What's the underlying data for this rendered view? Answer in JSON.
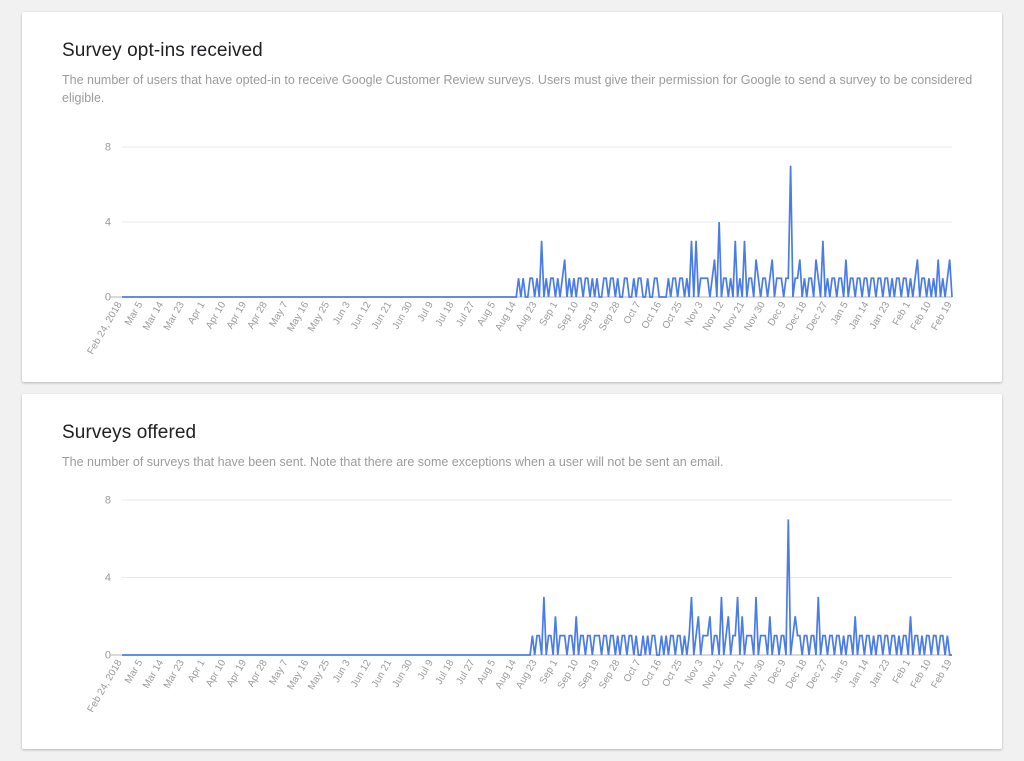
{
  "page": {
    "background_color": "#f1f1f1",
    "card_background": "#ffffff"
  },
  "cards": [
    {
      "id": "survey-opt-ins-received",
      "title": "Survey opt-ins received",
      "subtitle": "The number of users that have opted-in to receive Google Customer Review surveys. Users must give their permission for Google to send a survey to be considered eligible."
    },
    {
      "id": "surveys-offered",
      "title": "Surveys offered",
      "subtitle": "The number of surveys that have been sent. Note that there are some exceptions when a user will not be sent an email."
    }
  ],
  "chart_data": [
    {
      "type": "line",
      "title": "Survey opt-ins received",
      "xlabel": "",
      "ylabel": "",
      "grid": true,
      "legend": "none",
      "line_color": "#4a7ce8",
      "ylim": [
        0,
        8
      ],
      "yticks": [
        0,
        4,
        8
      ],
      "ytick_labels": [
        "0",
        "4",
        "8"
      ],
      "xtick_labels": [
        "Feb 24, 2018",
        "Mar 5",
        "Mar 14",
        "Mar 23",
        "Apr 1",
        "Apr 10",
        "Apr 19",
        "Apr 28",
        "May 7",
        "May 16",
        "May 25",
        "Jun 3",
        "Jun 12",
        "Jun 21",
        "Jun 30",
        "Jul 9",
        "Jul 18",
        "Jul 27",
        "Aug 5",
        "Aug 14",
        "Aug 23",
        "Sep 1",
        "Sep 10",
        "Sep 19",
        "Sep 28",
        "Oct 7",
        "Oct 16",
        "Oct 25",
        "Nov 3",
        "Nov 12",
        "Nov 21",
        "Nov 30",
        "Dec 9",
        "Dec 18",
        "Dec 27",
        "Jan 5",
        "Jan 14",
        "Jan 23",
        "Feb 1",
        "Feb 10",
        "Feb 19"
      ],
      "xtick_interval_days": 9,
      "x_start_date": "Feb 24, 2018",
      "x_end_date": "Feb 19",
      "n_points": 361,
      "values": [
        0,
        0,
        0,
        0,
        0,
        0,
        0,
        0,
        0,
        0,
        0,
        0,
        0,
        0,
        0,
        0,
        0,
        0,
        0,
        0,
        0,
        0,
        0,
        0,
        0,
        0,
        0,
        0,
        0,
        0,
        0,
        0,
        0,
        0,
        0,
        0,
        0,
        0,
        0,
        0,
        0,
        0,
        0,
        0,
        0,
        0,
        0,
        0,
        0,
        0,
        0,
        0,
        0,
        0,
        0,
        0,
        0,
        0,
        0,
        0,
        0,
        0,
        0,
        0,
        0,
        0,
        0,
        0,
        0,
        0,
        0,
        0,
        0,
        0,
        0,
        0,
        0,
        0,
        0,
        0,
        0,
        0,
        0,
        0,
        0,
        0,
        0,
        0,
        0,
        0,
        0,
        0,
        0,
        0,
        0,
        0,
        0,
        0,
        0,
        0,
        0,
        0,
        0,
        0,
        0,
        0,
        0,
        0,
        0,
        0,
        0,
        0,
        0,
        0,
        0,
        0,
        0,
        0,
        0,
        0,
        0,
        0,
        0,
        0,
        0,
        0,
        0,
        0,
        0,
        0,
        0,
        0,
        0,
        0,
        0,
        0,
        0,
        0,
        0,
        0,
        0,
        0,
        0,
        0,
        0,
        0,
        0,
        0,
        0,
        0,
        0,
        0,
        0,
        0,
        0,
        0,
        0,
        0,
        0,
        0,
        0,
        0,
        0,
        0,
        0,
        0,
        0,
        0,
        0,
        0,
        0,
        0,
        1,
        0,
        1,
        0,
        0,
        1,
        1,
        0,
        1,
        0,
        3,
        0,
        1,
        0,
        1,
        1,
        0,
        1,
        0,
        1,
        2,
        0,
        1,
        0,
        1,
        0,
        1,
        1,
        0,
        1,
        1,
        0,
        1,
        0,
        1,
        0,
        0,
        1,
        1,
        0,
        1,
        1,
        0,
        1,
        0,
        0,
        1,
        1,
        0,
        0,
        1,
        0,
        1,
        1,
        0,
        0,
        1,
        0,
        0,
        1,
        1,
        0,
        0,
        0,
        0,
        1,
        0,
        1,
        1,
        0,
        1,
        1,
        0,
        1,
        0,
        3,
        0,
        3,
        0,
        1,
        1,
        1,
        1,
        0,
        1,
        2,
        0,
        4,
        0,
        1,
        1,
        0,
        1,
        0,
        3,
        0,
        1,
        0,
        3,
        0,
        1,
        1,
        0,
        2,
        1,
        0,
        1,
        1,
        0,
        1,
        2,
        0,
        1,
        1,
        1,
        0,
        1,
        1,
        7,
        0,
        1,
        1,
        2,
        0,
        1,
        0,
        1,
        1,
        0,
        2,
        1,
        0,
        3,
        0,
        1,
        0,
        1,
        1,
        0,
        1,
        1,
        0,
        2,
        0,
        1,
        1,
        0,
        1,
        1,
        0,
        1,
        1,
        0,
        1,
        1,
        0,
        1,
        1,
        0,
        1,
        1,
        0,
        1,
        0,
        1,
        1,
        0,
        1,
        1,
        0,
        1,
        0,
        1,
        2,
        0,
        1,
        1,
        0,
        1,
        0,
        1,
        0,
        2,
        0,
        1,
        0,
        1,
        2,
        0
      ]
    },
    {
      "type": "line",
      "title": "Surveys offered",
      "xlabel": "",
      "ylabel": "",
      "grid": true,
      "legend": "none",
      "line_color": "#4a7ce8",
      "ylim": [
        0,
        8
      ],
      "yticks": [
        0,
        4,
        8
      ],
      "ytick_labels": [
        "0",
        "4",
        "8"
      ],
      "xtick_labels": [
        "Feb 24, 2018",
        "Mar 5",
        "Mar 14",
        "Mar 23",
        "Apr 1",
        "Apr 10",
        "Apr 19",
        "Apr 28",
        "May 7",
        "May 16",
        "May 25",
        "Jun 3",
        "Jun 12",
        "Jun 21",
        "Jun 30",
        "Jul 9",
        "Jul 18",
        "Jul 27",
        "Aug 5",
        "Aug 14",
        "Aug 23",
        "Sep 1",
        "Sep 10",
        "Sep 19",
        "Sep 28",
        "Oct 7",
        "Oct 16",
        "Oct 25",
        "Nov 3",
        "Nov 12",
        "Nov 21",
        "Nov 30",
        "Dec 9",
        "Dec 18",
        "Dec 27",
        "Jan 5",
        "Jan 14",
        "Jan 23",
        "Feb 1",
        "Feb 10",
        "Feb 19"
      ],
      "xtick_interval_days": 9,
      "x_start_date": "Feb 24, 2018",
      "x_end_date": "Feb 19",
      "n_points": 361,
      "values": [
        0,
        0,
        0,
        0,
        0,
        0,
        0,
        0,
        0,
        0,
        0,
        0,
        0,
        0,
        0,
        0,
        0,
        0,
        0,
        0,
        0,
        0,
        0,
        0,
        0,
        0,
        0,
        0,
        0,
        0,
        0,
        0,
        0,
        0,
        0,
        0,
        0,
        0,
        0,
        0,
        0,
        0,
        0,
        0,
        0,
        0,
        0,
        0,
        0,
        0,
        0,
        0,
        0,
        0,
        0,
        0,
        0,
        0,
        0,
        0,
        0,
        0,
        0,
        0,
        0,
        0,
        0,
        0,
        0,
        0,
        0,
        0,
        0,
        0,
        0,
        0,
        0,
        0,
        0,
        0,
        0,
        0,
        0,
        0,
        0,
        0,
        0,
        0,
        0,
        0,
        0,
        0,
        0,
        0,
        0,
        0,
        0,
        0,
        0,
        0,
        0,
        0,
        0,
        0,
        0,
        0,
        0,
        0,
        0,
        0,
        0,
        0,
        0,
        0,
        0,
        0,
        0,
        0,
        0,
        0,
        0,
        0,
        0,
        0,
        0,
        0,
        0,
        0,
        0,
        0,
        0,
        0,
        0,
        0,
        0,
        0,
        0,
        0,
        0,
        0,
        0,
        0,
        0,
        0,
        0,
        0,
        0,
        0,
        0,
        0,
        0,
        0,
        0,
        0,
        0,
        0,
        0,
        0,
        0,
        0,
        0,
        0,
        0,
        0,
        0,
        0,
        0,
        0,
        0,
        0,
        0,
        0,
        0,
        0,
        0,
        0,
        0,
        0,
        1,
        0,
        1,
        1,
        0,
        3,
        0,
        1,
        1,
        0,
        2,
        0,
        1,
        1,
        1,
        0,
        1,
        1,
        0,
        2,
        0,
        1,
        1,
        0,
        1,
        1,
        0,
        1,
        1,
        1,
        0,
        1,
        1,
        0,
        1,
        1,
        0,
        1,
        0,
        1,
        1,
        0,
        1,
        1,
        0,
        1,
        0,
        0,
        1,
        0,
        1,
        0,
        1,
        1,
        0,
        0,
        1,
        0,
        1,
        0,
        1,
        1,
        0,
        1,
        1,
        0,
        1,
        0,
        1,
        3,
        0,
        1,
        2,
        0,
        1,
        1,
        1,
        2,
        0,
        1,
        1,
        0,
        3,
        0,
        1,
        2,
        0,
        1,
        1,
        3,
        0,
        2,
        0,
        1,
        1,
        1,
        0,
        3,
        0,
        1,
        1,
        1,
        0,
        2,
        0,
        1,
        1,
        0,
        1,
        1,
        0,
        7,
        0,
        1,
        2,
        1,
        1,
        0,
        1,
        1,
        0,
        1,
        1,
        0,
        3,
        0,
        1,
        1,
        0,
        1,
        1,
        0,
        1,
        1,
        0,
        1,
        0,
        1,
        1,
        0,
        2,
        0,
        1,
        1,
        0,
        1,
        1,
        0,
        1,
        0,
        1,
        1,
        0,
        1,
        1,
        0,
        1,
        1,
        0,
        1,
        0,
        1,
        1,
        0,
        2,
        0,
        1,
        1,
        0,
        1,
        0,
        1,
        1,
        0,
        1,
        1,
        0,
        1,
        1,
        0,
        1,
        0,
        0
      ]
    }
  ]
}
